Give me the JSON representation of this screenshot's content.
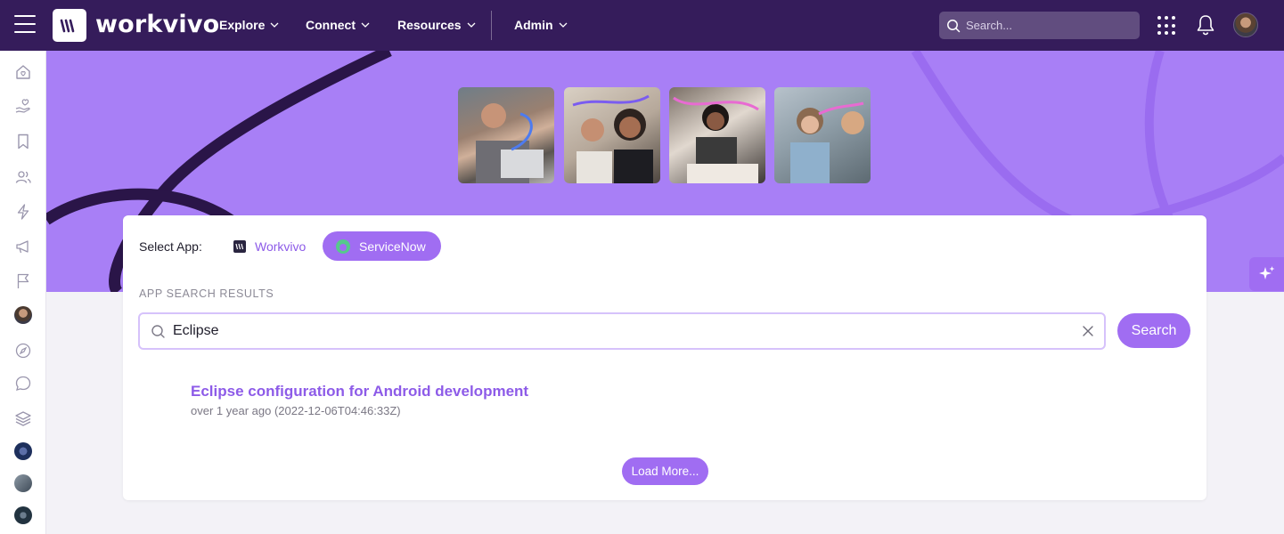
{
  "topbar": {
    "brand": "workvivo",
    "nav": [
      {
        "label": "Explore"
      },
      {
        "label": "Connect"
      },
      {
        "label": "Resources"
      },
      {
        "label": "Admin"
      }
    ],
    "search_placeholder": "Search..."
  },
  "sidebar": {
    "items": [
      "home-icon",
      "heart-hand-icon",
      "bookmark-icon",
      "people-icon",
      "lightning-icon",
      "megaphone-icon",
      "flag-icon",
      "user-avatar",
      "compass-icon",
      "chat-bubble-icon",
      "layers-icon",
      "space-avatar-1",
      "space-avatar-2",
      "space-avatar-3"
    ]
  },
  "app_selector": {
    "label": "Select App:",
    "options": [
      {
        "label": "Workvivo"
      },
      {
        "label": "ServiceNow"
      }
    ]
  },
  "results": {
    "section_label": "APP SEARCH RESULTS",
    "query": "Eclipse",
    "search_button": "Search",
    "items": [
      {
        "title": "Eclipse configuration for Android development",
        "meta": "over 1 year ago (2022-12-06T04:46:33Z)"
      }
    ],
    "load_more": "Load More..."
  },
  "colors": {
    "topbar": "#351c5b",
    "hero": "#a87ff6",
    "accent": "#a06df2",
    "link": "#8d5be8"
  }
}
